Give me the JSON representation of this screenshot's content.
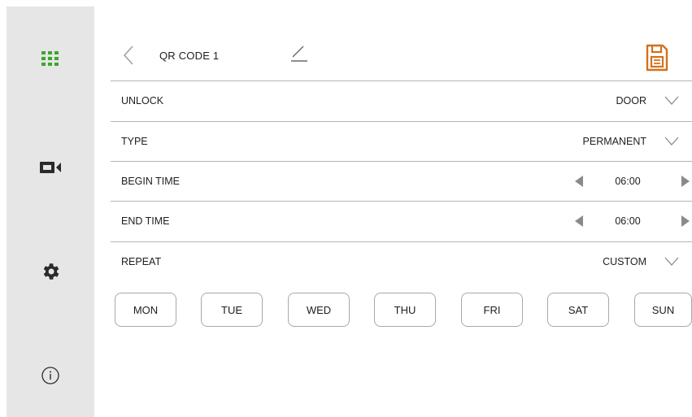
{
  "sidebar": {
    "items": [
      {
        "icon": "apps-grid-icon",
        "color": "#3aa82a"
      },
      {
        "icon": "video-camera-icon"
      },
      {
        "icon": "gear-icon"
      },
      {
        "icon": "info-icon"
      }
    ]
  },
  "header": {
    "title": "QR CODE 1",
    "save_color": "#d4701c"
  },
  "rows": {
    "unlock": {
      "label": "UNLOCK",
      "value": "DOOR"
    },
    "type": {
      "label": "TYPE",
      "value": "PERMANENT"
    },
    "begin_time": {
      "label": "BEGIN TIME",
      "value": "06:00"
    },
    "end_time": {
      "label": "END TIME",
      "value": "06:00"
    },
    "repeat": {
      "label": "REPEAT",
      "value": "CUSTOM"
    }
  },
  "days": [
    "MON",
    "TUE",
    "WED",
    "THU",
    "FRI",
    "SAT",
    "SUN"
  ]
}
